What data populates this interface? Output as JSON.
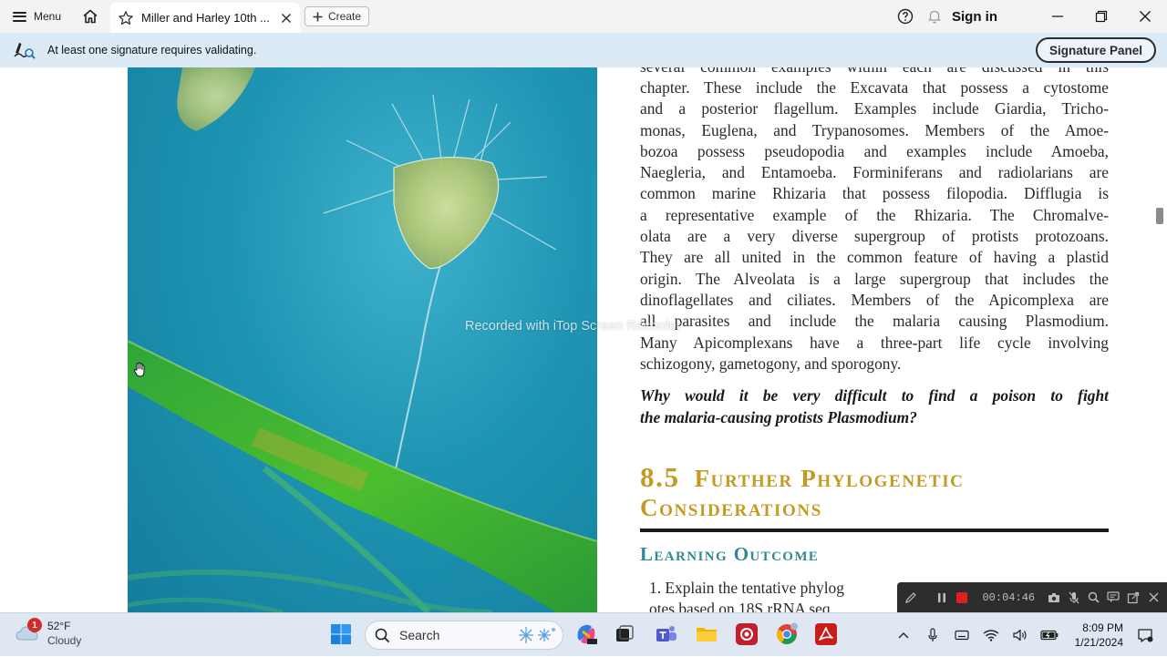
{
  "titlebar": {
    "menu_label": "Menu",
    "tab_title": "Miller and Harley 10th ...",
    "create_label": "Create",
    "signin_label": "Sign in"
  },
  "signature_bar": {
    "message": "At least one signature requires validating.",
    "panel_button": "Signature Panel"
  },
  "document": {
    "body_lines": [
      "several common examples within each are discussed in this",
      "chapter. These include the Excavata that possess a cytostome",
      "and a posterior flagellum. Examples include Giardia, Tricho-",
      "monas, Euglena, and Trypanosomes. Members of the Amoe-",
      "bozoa possess pseudopodia and examples include Amoeba,",
      "Naegleria, and Entamoeba. Forminiferans and radiolarians are",
      "common marine Rhizaria that possess filopodia. Difflugia is",
      "a representative example of the Rhizaria. The Chromalve-",
      "olata are a very diverse supergroup of protists protozoans.",
      "They are all united in the common feature of having a plastid",
      "origin. The Alveolata is a large supergroup that includes the",
      "dinoflagellates and ciliates. Members of the Apicomplexa are",
      "all parasites and include the malaria causing Plasmodium.",
      "Many Apicomplexans have a three-part life cycle involving",
      "schizogony, gametogony, and sporogony."
    ],
    "question_lines": [
      "Why would it be very difficult to find  a poison to fight",
      "the malaria-causing protists Plasmodium?"
    ],
    "section_number": "8.5",
    "section_title_1": "Further Phylogenetic",
    "section_title_2": "Considerations",
    "learning_outcome_heading": "Learning Outcome",
    "outcome_lines": [
      "1.  Explain the tentative phylog",
      "     otes based on 18S rRNA seq"
    ],
    "watermark": "Recorded with iTop Screen Recorder"
  },
  "recorder": {
    "elapsed": "00:04:46"
  },
  "taskbar": {
    "weather_temp": "52°F",
    "weather_desc": "Cloudy",
    "notification_count": "1",
    "search_placeholder": "Search",
    "time": "8:09 PM",
    "date": "1/21/2024"
  },
  "colors": {
    "section_gold": "#c49a22",
    "outcome_teal": "#2e8a92",
    "signature_bar": "#dceaf6",
    "record_red": "#e02020",
    "acrobat_red": "#c91d1d"
  }
}
